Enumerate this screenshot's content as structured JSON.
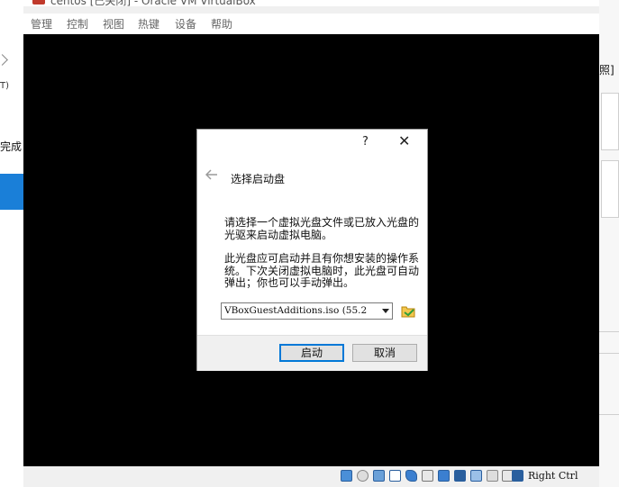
{
  "window": {
    "title": "centos [已关闭] - Oracle VM VirtualBox",
    "minimize_icon": "minimize-icon",
    "close_icon": "close-icon"
  },
  "menu": [
    "管理",
    "控制",
    "视图",
    "热键",
    "设备",
    "帮助"
  ],
  "background": {
    "left_text_1": "T)",
    "left_text_2": "完成",
    "right_text": "照]"
  },
  "dialog": {
    "help": "?",
    "close": "✕",
    "back": "🡐",
    "heading": "选择启动盘",
    "paragraph1": "请选择一个虚拟光盘文件或已放入光盘的光驱来启动虚拟电脑。",
    "paragraph2": "此光盘应可启动并且有你想安装的操作系统。下次关闭虚拟电脑时，此光盘可自动弹出；你也可以手动弹出。",
    "combo_value": "VBoxGuestAdditions.iso (55.2",
    "folder_icon": "folder-icon",
    "start_button": "启动",
    "cancel_button": "取消"
  },
  "statusbar": {
    "host_key": "Right Ctrl",
    "icons": [
      "hard-disk-icon",
      "optical-drive-icon",
      "audio-icon",
      "network-icon",
      "usb-icon",
      "shared-folder-icon",
      "display-icon",
      "video-capture-icon",
      "cpu-icon",
      "mouse-integration-icon",
      "arrow-down-icon"
    ]
  }
}
